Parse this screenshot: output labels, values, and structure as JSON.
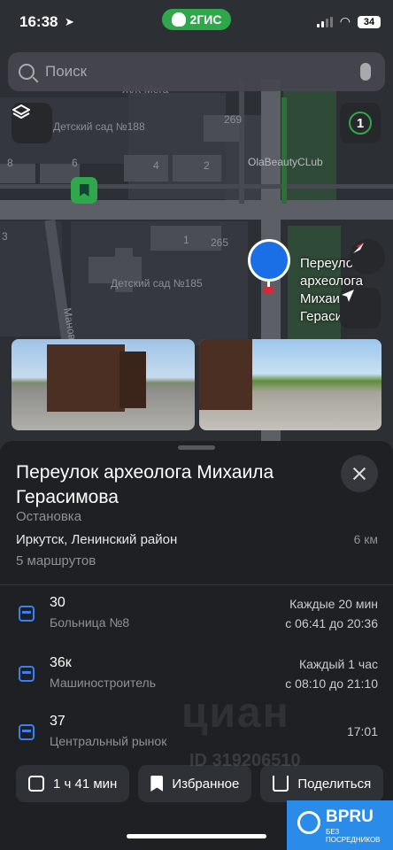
{
  "status_bar": {
    "time": "16:38",
    "brand": "2ГИС",
    "battery": "34"
  },
  "search": {
    "placeholder": "Поиск"
  },
  "map": {
    "badge_count": "1",
    "labels": [
      "Детский сад №188",
      "269",
      "8",
      "6",
      "4",
      "2",
      "OlaBeautyCLub",
      "3",
      "1",
      "265",
      "Детский сад №185",
      "Ж/К Мега",
      "Манова"
    ],
    "stop_title_line1": "Переулок археолога",
    "stop_title_line2": "Михаила Герасимова",
    "colors": {
      "pin": "#1a6fe6",
      "brand_green": "#2ea84a"
    }
  },
  "sheet": {
    "title": "Переулок археолога Михаила Герасимова",
    "type": "Остановка",
    "city": "Иркутск, Ленинский район",
    "distance": "6 км",
    "routes_count": "5 маршрутов",
    "routes": [
      {
        "number": "30",
        "destination": "Больница №8",
        "frequency": "Каждые 20 мин",
        "hours": "с 06:41 до 20:36"
      },
      {
        "number": "36к",
        "destination": "Машиностроитель",
        "frequency": "Каждый 1 час",
        "hours": "с 08:10 до 21:10"
      },
      {
        "number": "37",
        "destination": "Центральный рынок",
        "frequency": "",
        "hours": "17:01"
      }
    ],
    "actions": {
      "route_time": "1 ч 41 мин",
      "favorites": "Избранное",
      "share": "Поделиться"
    }
  },
  "watermark": {
    "text": "циан",
    "id": "ID 319206510"
  },
  "bpru": {
    "title": "BPRU",
    "subtitle": "БЕЗ ПОСРЕДНИКОВ"
  }
}
